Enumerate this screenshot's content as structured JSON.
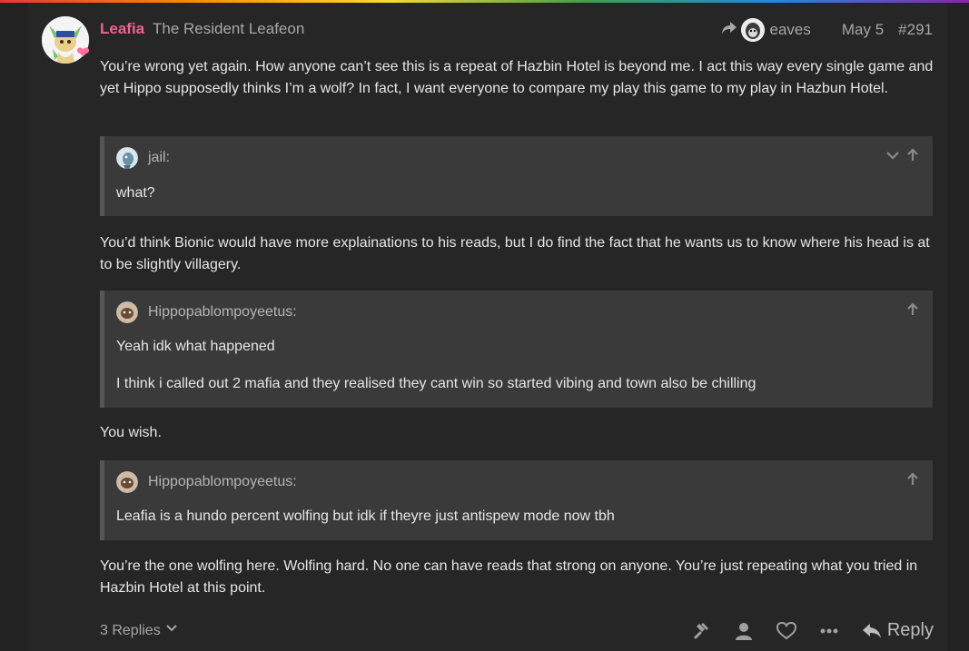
{
  "post": {
    "username": "Leafia",
    "user_title": "The Resident Leafeon",
    "reply_to_user": "eaves",
    "date": "May 5",
    "post_number": "#291",
    "paragraphs": [
      "You’re wrong yet again. How anyone can’t see this is a repeat of Hazbin Hotel is beyond me. I act this way every single game and yet Hippo supposedly thinks I’m a wolf? In fact, I want everyone to compare my play this game to my play in Hazbun Hotel.",
      "You’d think Bionic would have more explainations to his reads, but I do find the fact that he wants us to know where his head is at to be slightly villagery.",
      "You wish.",
      "You’re the one wolfing here. Wolfing hard. No one can have reads that strong on anyone. You’re just repeating what you tried in Hazbin Hotel at this point."
    ],
    "quotes": [
      {
        "author": "jail:",
        "lines": [
          "what?"
        ]
      },
      {
        "author": "Hippopablompoyeetus:",
        "lines": [
          "Yeah idk what happened",
          "I think i called out 2 mafia and they realised they cant win so started vibing and town also be chilling"
        ]
      },
      {
        "author": "Hippopablompoyeetus:",
        "lines": [
          "Leafia is a hundo percent wolfing but idk if theyre just antispew mode now tbh"
        ]
      }
    ],
    "footer": {
      "replies_label": "3 Replies",
      "reply_label": "Reply"
    }
  },
  "colors": {
    "username": "#f06292",
    "background": "#262626",
    "quote_bg": "#3a3a3a"
  }
}
